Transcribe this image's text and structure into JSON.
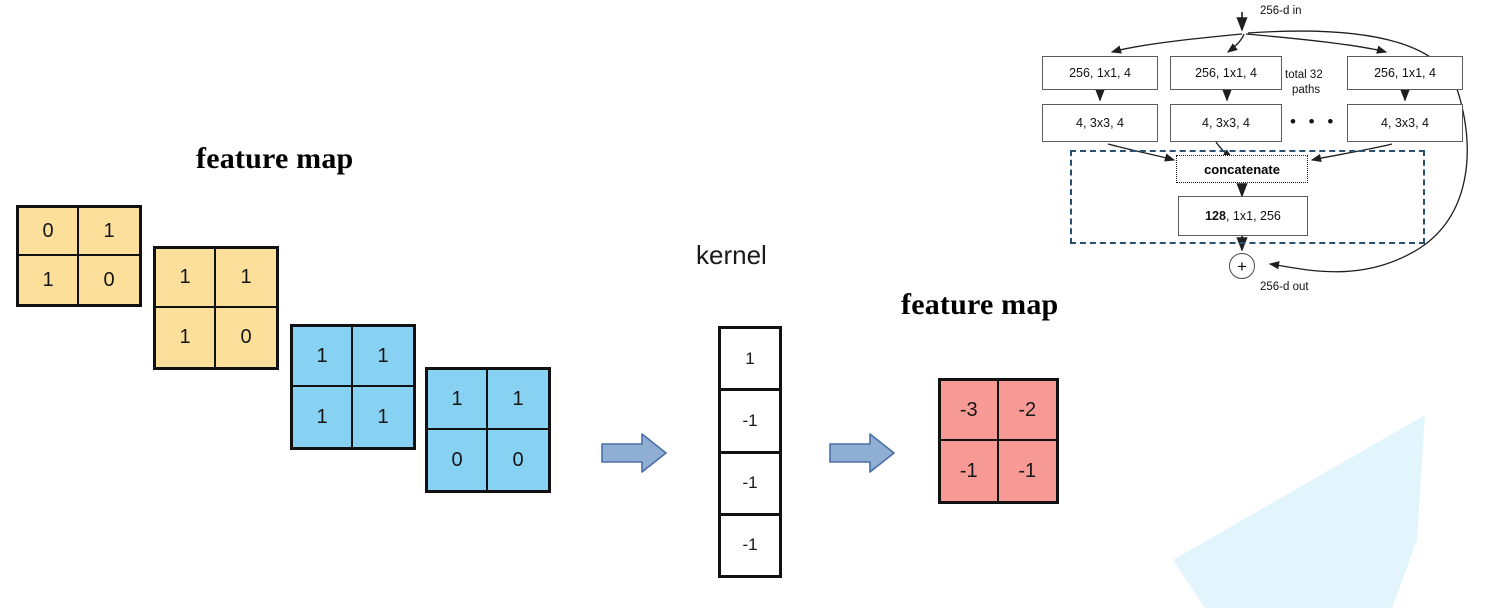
{
  "labels": {
    "feature_map_left": "feature map",
    "kernel": "kernel",
    "feature_map_right": "feature map"
  },
  "input_feature_maps": [
    {
      "name": "yellow-map-1",
      "color": "#fbdf9a",
      "values": [
        "0",
        "1",
        "1",
        "0"
      ]
    },
    {
      "name": "yellow-map-2",
      "color": "#fbdf9a",
      "values": [
        "1",
        "1",
        "1",
        "0"
      ]
    },
    {
      "name": "blue-map-1",
      "color": "#87d2f2",
      "values": [
        "1",
        "1",
        "1",
        "1"
      ]
    },
    {
      "name": "blue-map-2",
      "color": "#87d2f2",
      "values": [
        "1",
        "1",
        "0",
        "0"
      ]
    }
  ],
  "kernel": {
    "values": [
      "1",
      "-1",
      "-1",
      "-1"
    ]
  },
  "output_feature_map": {
    "color": "#f79a96",
    "values": [
      "-3",
      "-2",
      "-1",
      "-1"
    ]
  },
  "arrows": [
    {
      "name": "arrow-to-kernel"
    },
    {
      "name": "arrow-to-output"
    }
  ],
  "resnext": {
    "input_label": "256-d in",
    "output_label": "256-d out",
    "paths_label_line1": "total 32",
    "paths_label_line2": "paths",
    "ellipsis": "• • •",
    "columns": [
      {
        "reduce": "256, 1x1, 4",
        "conv": "4, 3x3, 4"
      },
      {
        "reduce": "256, 1x1, 4",
        "conv": "4, 3x3, 4"
      },
      {
        "reduce": "256, 1x1, 4",
        "conv": "4, 3x3, 4"
      }
    ],
    "concatenate": "concatenate",
    "expand_bold": "128",
    "expand_rest": ", 1x1, 256",
    "sum_symbol": "+",
    "dashed_color": "#2b4f72"
  },
  "background_shape": {
    "name": "decorative-polygon",
    "color": "#e2f4fc"
  }
}
